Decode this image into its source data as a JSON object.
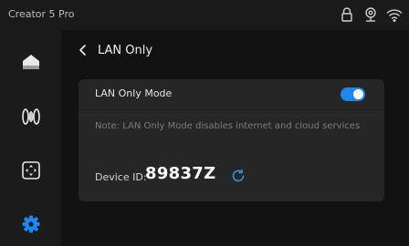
{
  "app": {
    "title": "Creator 5 Pro"
  },
  "status_icons": [
    "lock-icon",
    "webcam-icon",
    "wifi-icon"
  ],
  "sidebar": {
    "items": [
      {
        "icon": "home-icon",
        "active": false
      },
      {
        "icon": "filament-icon",
        "active": false
      },
      {
        "icon": "control-pad-icon",
        "active": false
      },
      {
        "icon": "settings-gear-icon",
        "active": true
      }
    ]
  },
  "header": {
    "title": "LAN Only"
  },
  "lan_mode": {
    "label": "LAN Only Mode",
    "enabled": true,
    "note": "Note: LAN Only Mode disables internet and cloud services"
  },
  "device": {
    "label": "Device ID:",
    "id": "89837Z"
  },
  "colors": {
    "accent": "#1e87f0",
    "background": "#121212",
    "card": "#262626",
    "sidebar": "#1b1b1b"
  }
}
